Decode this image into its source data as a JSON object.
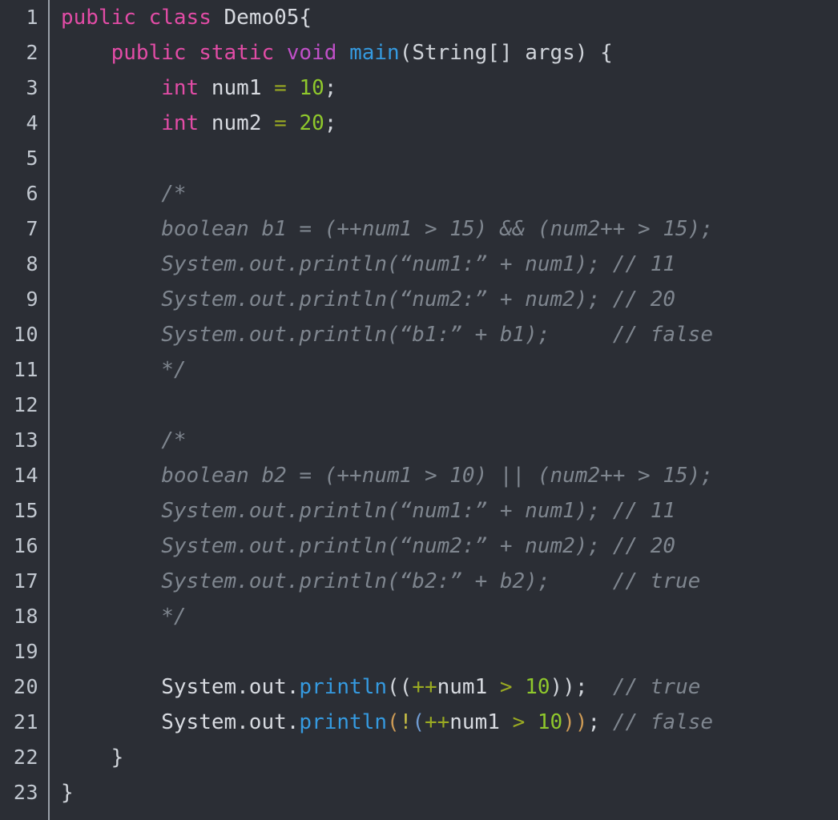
{
  "editor": {
    "file_name": "Demo05.java",
    "language": "java",
    "total_lines": 23,
    "theme": "dark",
    "colors": {
      "background": "#2b2e35",
      "gutter_border": "#9aa0a8",
      "line_number": "#c2c8d0",
      "default_text": "#d7dae0",
      "keyword": "#e24ca6",
      "method": "#359ae0",
      "number": "#8fc82c",
      "operator": "#9aaa22",
      "comment": "#7f868f",
      "bracket_gold": "#cc9a55",
      "bracket_blue": "#6f9bd2",
      "negation": "#c8c045"
    }
  },
  "line_numbers": [
    "1",
    "2",
    "3",
    "4",
    "5",
    "6",
    "7",
    "8",
    "9",
    "10",
    "11",
    "12",
    "13",
    "14",
    "15",
    "16",
    "17",
    "18",
    "19",
    "20",
    "21",
    "22",
    "23"
  ],
  "code_lines": [
    {
      "n": 1,
      "text": "public class Demo05{"
    },
    {
      "n": 2,
      "text": "    public static void main(String[] args) {"
    },
    {
      "n": 3,
      "text": "        int num1 = 10;"
    },
    {
      "n": 4,
      "text": "        int num2 = 20;"
    },
    {
      "n": 5,
      "text": ""
    },
    {
      "n": 6,
      "text": "        /*"
    },
    {
      "n": 7,
      "text": "        boolean b1 = (++num1 > 15) && (num2++ > 15);"
    },
    {
      "n": 8,
      "text": "        System.out.println(“num1:” + num1); // 11"
    },
    {
      "n": 9,
      "text": "        System.out.println(“num2:” + num2); // 20"
    },
    {
      "n": 10,
      "text": "        System.out.println(“b1:” + b1);     // false"
    },
    {
      "n": 11,
      "text": "        */"
    },
    {
      "n": 12,
      "text": ""
    },
    {
      "n": 13,
      "text": "        /*"
    },
    {
      "n": 14,
      "text": "        boolean b2 = (++num1 > 10) || (num2++ > 15);"
    },
    {
      "n": 15,
      "text": "        System.out.println(“num1:” + num1); // 11"
    },
    {
      "n": 16,
      "text": "        System.out.println(“num2:” + num2); // 20"
    },
    {
      "n": 17,
      "text": "        System.out.println(“b2:” + b2);     // true"
    },
    {
      "n": 18,
      "text": "        */"
    },
    {
      "n": 19,
      "text": ""
    },
    {
      "n": 20,
      "text": "        System.out.println((++num1 > 10));  // true"
    },
    {
      "n": 21,
      "text": "        System.out.println(!(++num1 > 10)); // false"
    },
    {
      "n": 22,
      "text": "    }"
    },
    {
      "n": 23,
      "text": "}"
    }
  ],
  "tokens": {
    "l1": {
      "kw_public": "public",
      "kw_class": "class",
      "name": "Demo05{"
    },
    "l2": {
      "kw_public": "public",
      "kw_static": "static",
      "kw_void": "void",
      "method": "main",
      "sig": "(String[] args) {"
    },
    "l3": {
      "kw_int": "int",
      "var": "num1",
      "eq": "=",
      "num": "10",
      "semi": ";"
    },
    "l4": {
      "kw_int": "int",
      "var": "num2",
      "eq": "=",
      "num": "20",
      "semi": ";"
    },
    "l6": {
      "comment": "/*"
    },
    "l7": {
      "comment": "boolean b1 = (++num1 > 15) && (num2++ > 15);"
    },
    "l8": {
      "comment": "System.out.println(“num1:” + num1); // 11"
    },
    "l9": {
      "comment": "System.out.println(“num2:” + num2); // 20"
    },
    "l10": {
      "comment": "System.out.println(“b1:” + b1);     // false"
    },
    "l11": {
      "comment": "*/"
    },
    "l13": {
      "comment": "/*"
    },
    "l14": {
      "comment": "boolean b2 = (++num1 > 10) || (num2++ > 15);"
    },
    "l15": {
      "comment": "System.out.println(“num1:” + num1); // 11"
    },
    "l16": {
      "comment": "System.out.println(“num2:” + num2); // 20"
    },
    "l17": {
      "comment": "System.out.println(“b2:” + b2);     // true"
    },
    "l18": {
      "comment": "*/"
    },
    "l20": {
      "obj": "System.out.",
      "method": "println",
      "p1": "((",
      "inc": "++",
      "var": "num1",
      "gt": ">",
      "num": "10",
      "p2": "))",
      "semi": ";",
      "comment": "// true"
    },
    "l21": {
      "obj": "System.out.",
      "method": "println",
      "p1": "(",
      "bang": "!",
      "p2": "(",
      "inc": "++",
      "var": "num1",
      "gt": ">",
      "num": "10",
      "p3": "))",
      "semi": ";",
      "comment": "// false"
    },
    "l22": {
      "brace": "}"
    },
    "l23": {
      "brace": "}"
    }
  }
}
